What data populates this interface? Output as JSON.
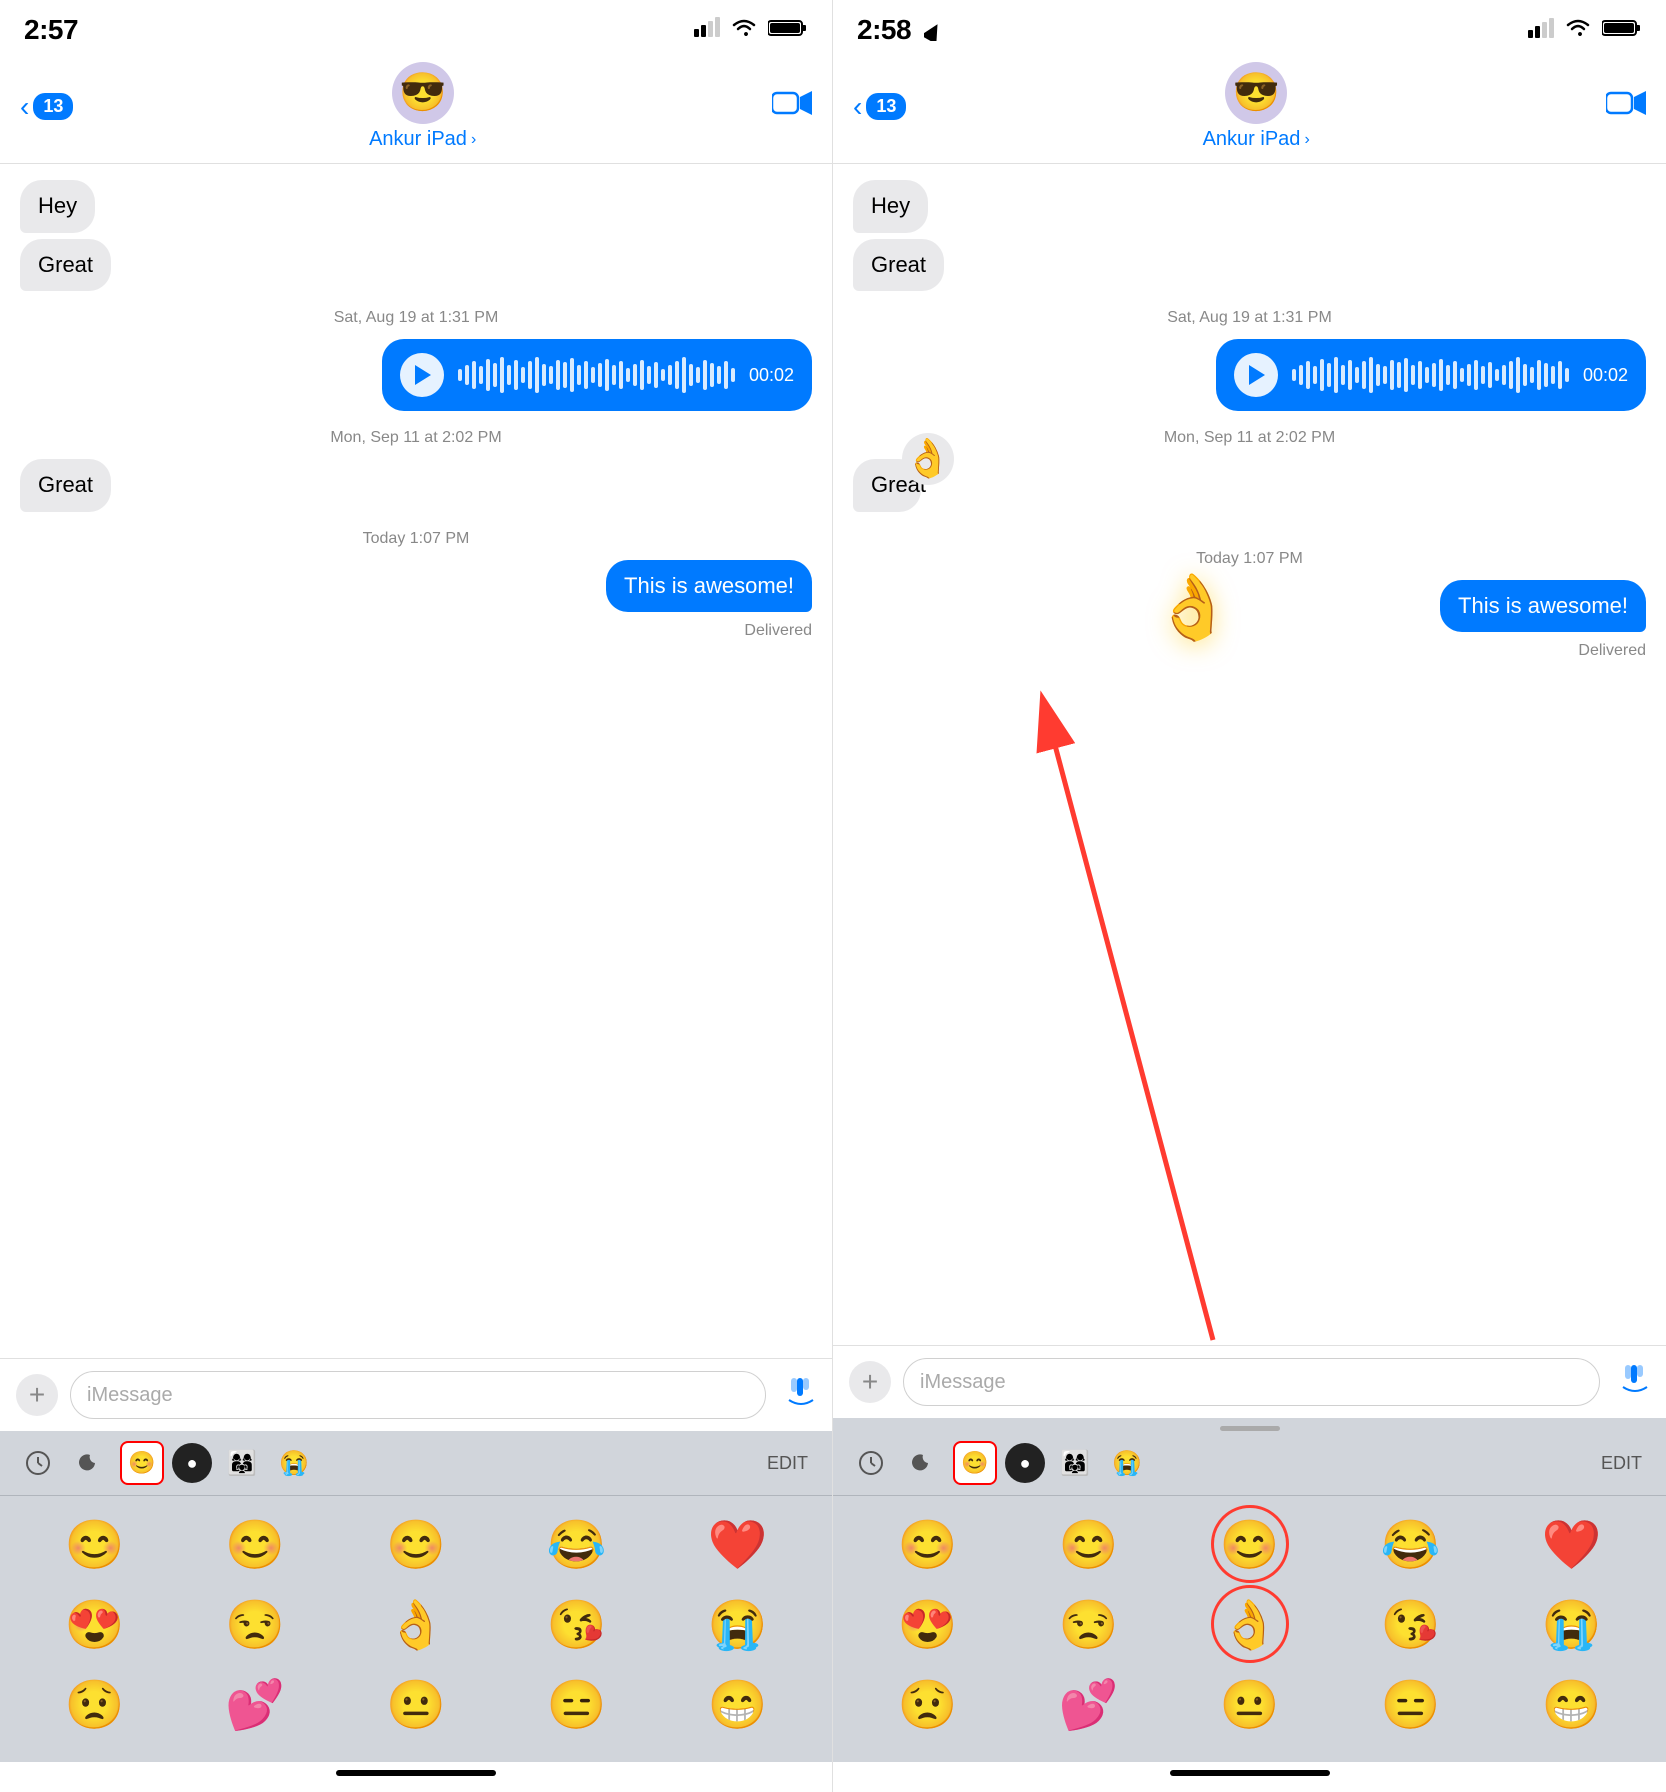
{
  "left_panel": {
    "status_time": "2:57",
    "contact_name": "Ankur iPad",
    "back_badge": "13",
    "messages": [
      {
        "type": "received",
        "text": "Hey"
      },
      {
        "type": "received",
        "text": "Great"
      },
      {
        "type": "timestamp",
        "text": "Sat, Aug 19 at 1:31 PM"
      },
      {
        "type": "audio",
        "duration": "00:02"
      },
      {
        "type": "timestamp",
        "text": "Mon, Sep 11 at 2:02 PM"
      },
      {
        "type": "received",
        "text": "Great"
      },
      {
        "type": "timestamp",
        "text": "Today 1:07 PM"
      },
      {
        "type": "sent",
        "text": "This is awesome!"
      },
      {
        "type": "delivered",
        "text": "Delivered"
      }
    ],
    "input_placeholder": "iMessage",
    "emoji_tabs": [
      "🕐",
      "🌙",
      "😊",
      "🎯",
      "👩‍👩‍👧‍👦",
      "😭"
    ],
    "edit_label": "EDIT",
    "emojis_row1": [
      "😊",
      "😊",
      "😊",
      "😂",
      "❤️"
    ],
    "emojis_row2": [
      "😍",
      "😒",
      "👌",
      "😘",
      "😭"
    ],
    "emojis_row3": [
      "😟",
      "💕",
      "😐",
      "😑",
      "😁"
    ]
  },
  "right_panel": {
    "status_time": "2:58",
    "contact_name": "Ankur iPad",
    "back_badge": "13",
    "messages": [
      {
        "type": "received",
        "text": "Hey"
      },
      {
        "type": "received",
        "text": "Great"
      },
      {
        "type": "timestamp",
        "text": "Sat, Aug 19 at 1:31 PM"
      },
      {
        "type": "audio",
        "duration": "00:02"
      },
      {
        "type": "timestamp",
        "text": "Mon, Sep 11 at 2:02 PM"
      },
      {
        "type": "received",
        "text": "Great",
        "reaction": "👌"
      },
      {
        "type": "timestamp",
        "text": "Today 1:07 PM"
      },
      {
        "type": "sent",
        "text": "This is awesome!"
      },
      {
        "type": "delivered",
        "text": "Delivered"
      }
    ],
    "input_placeholder": "iMessage",
    "emoji_tabs": [
      "🕐",
      "🌙",
      "😊",
      "🎯",
      "👩‍👩‍👧‍👦",
      "😭"
    ],
    "edit_label": "EDIT",
    "emojis_row1": [
      "😊",
      "😊",
      "😊",
      "😂",
      "❤️"
    ],
    "emojis_row2": [
      "😍",
      "😒",
      "👌",
      "😘",
      "😭"
    ],
    "emojis_row3": [
      "😟",
      "💕",
      "😐",
      "😑",
      "😁"
    ],
    "flying_emoji": "👌",
    "arrow_note": "Arrow pointing from emoji grid to bubble"
  }
}
